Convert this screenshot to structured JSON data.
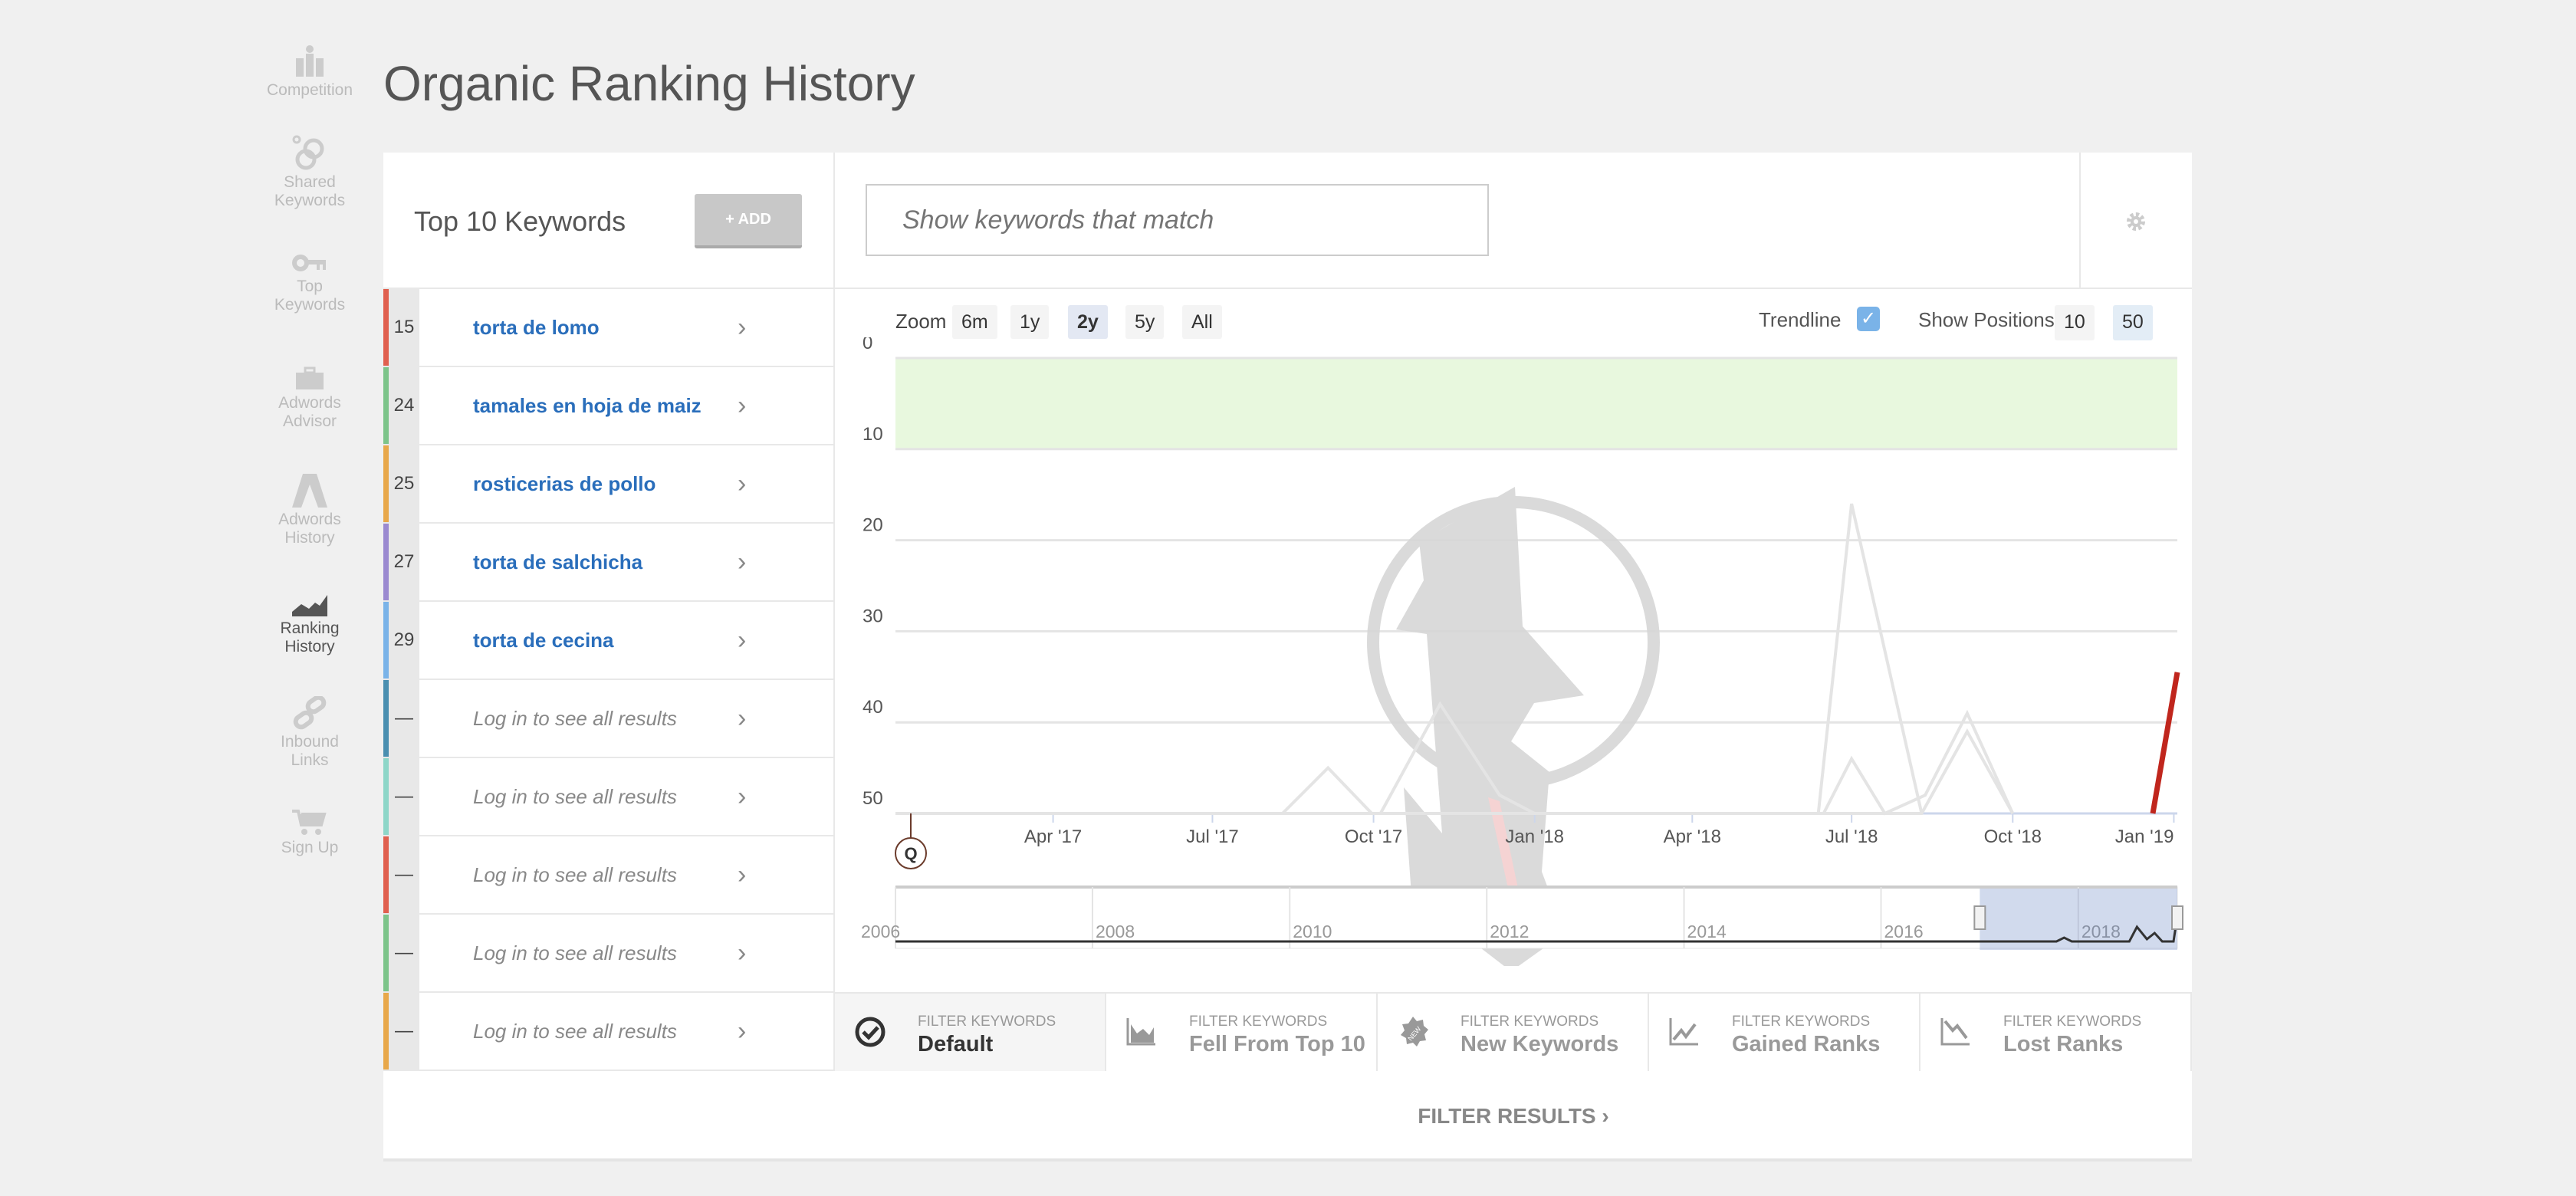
{
  "page_title": "Organic Ranking History",
  "sidebar": {
    "items": [
      {
        "label": "Competition",
        "icon": "competition-icon"
      },
      {
        "label": "Shared Keywords",
        "icon": "shared-keywords-icon"
      },
      {
        "label": "Top Keywords",
        "icon": "key-icon"
      },
      {
        "label": "Adwords Advisor",
        "icon": "briefcase-icon"
      },
      {
        "label": "Adwords History",
        "icon": "adwords-icon"
      },
      {
        "label": "Ranking History",
        "icon": "area-chart-icon",
        "active": true
      },
      {
        "label": "Inbound Links",
        "icon": "link-icon"
      },
      {
        "label": "Sign Up",
        "icon": "cart-icon"
      }
    ]
  },
  "keywords_panel": {
    "title": "Top 10 Keywords",
    "add_label": "+ ADD",
    "rows": [
      {
        "rank": "15",
        "keyword": "torta de lomo",
        "color": "#e0604f"
      },
      {
        "rank": "24",
        "keyword": "tamales en hoja de maiz",
        "color": "#7dc48a"
      },
      {
        "rank": "25",
        "keyword": "rosticerias de pollo",
        "color": "#e8a84a"
      },
      {
        "rank": "27",
        "keyword": "torta de salchicha",
        "color": "#9b8ad0"
      },
      {
        "rank": "29",
        "keyword": "torta de cecina",
        "color": "#7ab3e8"
      },
      {
        "rank": "—",
        "keyword": "Log in to see all results",
        "color": "#4a8fb0",
        "locked": true
      },
      {
        "rank": "—",
        "keyword": "Log in to see all results",
        "color": "#8ed6c8",
        "locked": true
      },
      {
        "rank": "—",
        "keyword": "Log in to see all results",
        "color": "#e0604f",
        "locked": true
      },
      {
        "rank": "—",
        "keyword": "Log in to see all results",
        "color": "#7dc48a",
        "locked": true
      },
      {
        "rank": "—",
        "keyword": "Log in to see all results",
        "color": "#e8a84a",
        "locked": true
      }
    ]
  },
  "search": {
    "placeholder": "Show keywords that match",
    "value": ""
  },
  "chart_controls": {
    "zoom_label": "Zoom",
    "zoom_options": [
      "6m",
      "1y",
      "2y",
      "5y",
      "All"
    ],
    "zoom_selected": "2y",
    "trendline_label": "Trendline",
    "trendline_checked": true,
    "positions_label": "Show Positions",
    "positions_options": [
      "10",
      "50"
    ],
    "positions_selected": "50",
    "marker_label": "Q"
  },
  "chart_data": {
    "type": "line",
    "y_reversed": true,
    "ylim": [
      0,
      50
    ],
    "yticks": [
      "0",
      "10",
      "20",
      "30",
      "40",
      "50"
    ],
    "xlim": [
      "2017-01-01",
      "2019-01-03"
    ],
    "xticks": [
      {
        "date": "2017-04-01",
        "label": "Apr '17"
      },
      {
        "date": "2017-07-01",
        "label": "Jul '17"
      },
      {
        "date": "2017-10-01",
        "label": "Oct '17"
      },
      {
        "date": "2018-01-01",
        "label": "Jan '18"
      },
      {
        "date": "2018-04-01",
        "label": "Apr '18"
      },
      {
        "date": "2018-07-01",
        "label": "Jul '18"
      },
      {
        "date": "2018-10-01",
        "label": "Oct '18"
      },
      {
        "date": "2019-01-01",
        "label": "Jan '19"
      }
    ],
    "highlight_band": [
      0,
      10
    ],
    "highlight_color": "#e8f8de",
    "grid": true,
    "series": [
      {
        "color": "#e4e4e4",
        "points": [
          [
            "2017-08-10",
            50
          ],
          [
            "2017-09-05",
            45
          ],
          [
            "2017-09-30",
            50
          ]
        ]
      },
      {
        "color": "#e4e4e4",
        "points": [
          [
            "2017-10-05",
            50
          ],
          [
            "2017-11-08",
            38
          ],
          [
            "2017-12-12",
            48
          ],
          [
            "2018-01-01",
            50
          ]
        ]
      },
      {
        "color": "#e4e4e4",
        "points": [
          [
            "2018-06-12",
            50
          ],
          [
            "2018-07-01",
            16
          ],
          [
            "2018-08-10",
            50
          ]
        ]
      },
      {
        "color": "#e4e4e4",
        "points": [
          [
            "2018-06-15",
            50
          ],
          [
            "2018-07-01",
            44
          ],
          [
            "2018-07-20",
            50
          ],
          [
            "2018-08-12",
            48
          ],
          [
            "2018-09-05",
            39
          ],
          [
            "2018-10-01",
            50
          ]
        ]
      },
      {
        "color": "#e4e4e4",
        "points": [
          [
            "2018-07-20",
            50
          ],
          [
            "2018-08-10",
            50
          ],
          [
            "2018-09-05",
            41
          ],
          [
            "2018-10-01",
            50
          ]
        ]
      },
      {
        "name": "",
        "color": "#c0261d",
        "trend": true,
        "points": [
          [
            "2018-12-20",
            50
          ],
          [
            "2019-01-03",
            34.5
          ]
        ]
      }
    ],
    "navigator": {
      "labels": [
        "2006",
        "2008",
        "2010",
        "2012",
        "2014",
        "2016",
        "2018"
      ],
      "range": [
        "2006-01-01",
        "2019-01-03"
      ],
      "selected": [
        "2017-01-01",
        "2019-01-03"
      ]
    }
  },
  "filters": [
    {
      "caption": "FILTER KEYWORDS",
      "label": "Default",
      "icon": "check-circle-icon",
      "active": true
    },
    {
      "caption": "FILTER KEYWORDS",
      "label": "Fell From Top 10",
      "icon": "area-chart-icon"
    },
    {
      "caption": "FILTER KEYWORDS",
      "label": "New Keywords",
      "icon": "new-badge-icon"
    },
    {
      "caption": "FILTER KEYWORDS",
      "label": "Gained Ranks",
      "icon": "trend-up-icon"
    },
    {
      "caption": "FILTER KEYWORDS",
      "label": "Lost Ranks",
      "icon": "trend-down-icon"
    }
  ],
  "filter_results_label": "FILTER RESULTS ›"
}
